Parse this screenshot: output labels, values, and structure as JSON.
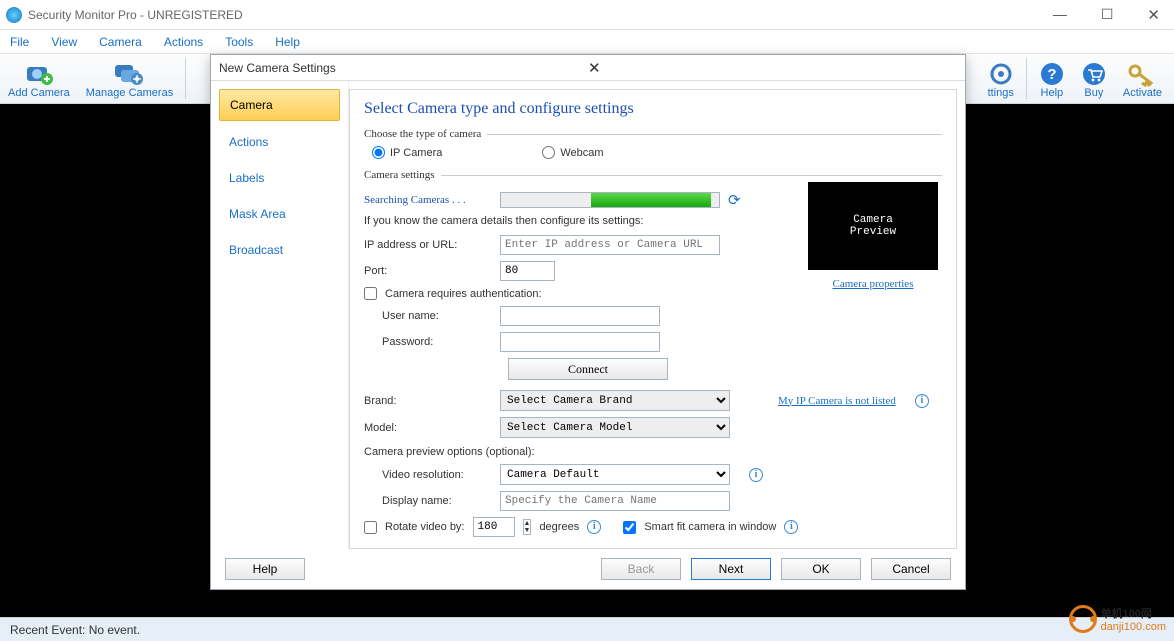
{
  "titlebar": {
    "title": "Security Monitor Pro - UNREGISTERED"
  },
  "menubar": [
    "File",
    "View",
    "Camera",
    "Actions",
    "Tools",
    "Help"
  ],
  "toolbar": {
    "left": [
      {
        "id": "add-camera",
        "label": "Add Camera"
      },
      {
        "id": "manage-cameras",
        "label": "Manage Cameras"
      }
    ],
    "right": [
      {
        "id": "settings",
        "label": "ttings"
      },
      {
        "id": "help",
        "label": "Help"
      },
      {
        "id": "buy",
        "label": "Buy"
      },
      {
        "id": "activate",
        "label": "Activate"
      }
    ]
  },
  "statusbar": {
    "text": "Recent Event:  No event."
  },
  "dialog": {
    "title": "New Camera Settings",
    "nav": [
      "Camera",
      "Actions",
      "Labels",
      "Mask Area",
      "Broadcast"
    ],
    "nav_active": 0,
    "heading": "Select Camera type and configure settings",
    "type_legend": "Choose the type of camera",
    "radios": {
      "ip": "IP Camera",
      "webcam": "Webcam",
      "selected": "ip"
    },
    "settings_legend": "Camera settings",
    "searching": "Searching Cameras . . .",
    "hint": "If you know the camera details then configure its settings:",
    "labels": {
      "ip": "IP address or URL:",
      "port": "Port:",
      "auth": "Camera requires authentication:",
      "user": "User name:",
      "pass": "Password:",
      "brand": "Brand:",
      "model": "Model:",
      "previewopts": "Camera preview options (optional):",
      "res": "Video resolution:",
      "disp": "Display name:",
      "rot": "Rotate video by:",
      "deg": "degrees",
      "smart": "Smart fit camera in window"
    },
    "values": {
      "ip_placeholder": "Enter IP address or Camera URL",
      "port": "80",
      "user": "",
      "pass": "",
      "brand": "Select Camera Brand",
      "model": "Select Camera Model",
      "res": "Camera Default",
      "disp_placeholder": "Specify the Camera Name",
      "rot": "180",
      "rot_checked": false,
      "auth_checked": false,
      "smart_checked": true
    },
    "connect": "Connect",
    "preview": {
      "label": "Camera\nPreview",
      "props": "Camera properties"
    },
    "notlisted": "My IP Camera is not listed",
    "footer": {
      "help": "Help",
      "back": "Back",
      "next": "Next",
      "ok": "OK",
      "cancel": "Cancel"
    }
  },
  "watermark": {
    "cn": "单机100网",
    "url": "danji100.com"
  }
}
